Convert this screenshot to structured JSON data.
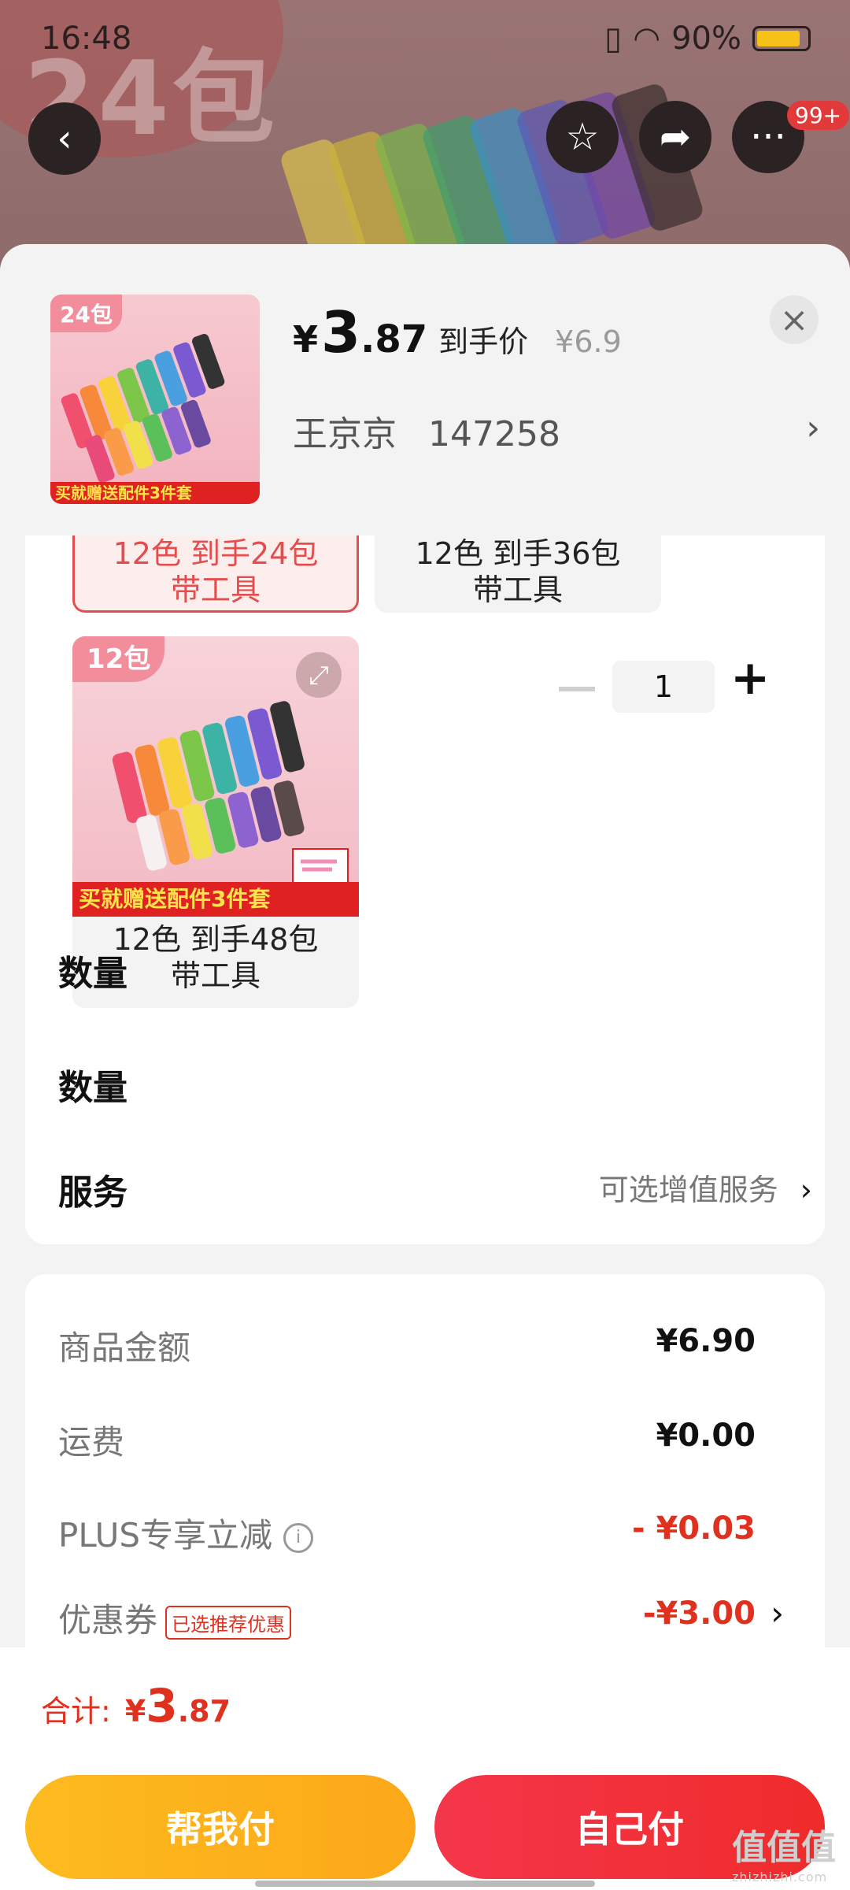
{
  "status": {
    "time": "16:48",
    "battery": "90%"
  },
  "background": {
    "big_text": "24包",
    "badge": "99+"
  },
  "header": {
    "currency": "¥",
    "price_int": "3",
    "price_dec": ".87",
    "price_label": "到手价",
    "original_price": "¥6.9",
    "spec_name": "王京京",
    "spec_code": "147258",
    "thumb_tag": "24包",
    "thumb_banner": "买就赠送配件3件套"
  },
  "options": [
    {
      "line1": "12色 到手24包",
      "line2": "带工具",
      "selected": true
    },
    {
      "line1": "12色 到手36包",
      "line2": "带工具",
      "selected": false
    },
    {
      "line1": "12色 到手48包",
      "line2": "带工具",
      "selected": false,
      "tag": "12包",
      "banner": "买就赠送配件3件套"
    }
  ],
  "quantity": {
    "label": "数量",
    "value": "1",
    "minus": "−",
    "plus": "+"
  },
  "service": {
    "label": "服务",
    "value": "可选增值服务"
  },
  "fees": {
    "goods_label": "商品金额",
    "goods_value": "¥6.90",
    "shipping_label": "运费",
    "shipping_value": "¥0.00",
    "plus_label": "PLUS专享立减",
    "plus_value": "- ¥0.03",
    "coupon_label": "优惠券",
    "coupon_tag": "已选推荐优惠",
    "coupon_value": "-¥3.00"
  },
  "footer": {
    "total_label": "合计:",
    "total_currency": "¥",
    "total_int": "3",
    "total_dec": ".87",
    "btn_help": "帮我付",
    "btn_self": "自己付"
  },
  "watermark": {
    "text": "值值值",
    "sub": "zhizhizhi.com"
  },
  "colors": {
    "accent_red": "#e0311f",
    "selected_border": "#e34d4d",
    "btn_yellow": "#fdbb1f",
    "btn_red": "#ef2b2b"
  }
}
